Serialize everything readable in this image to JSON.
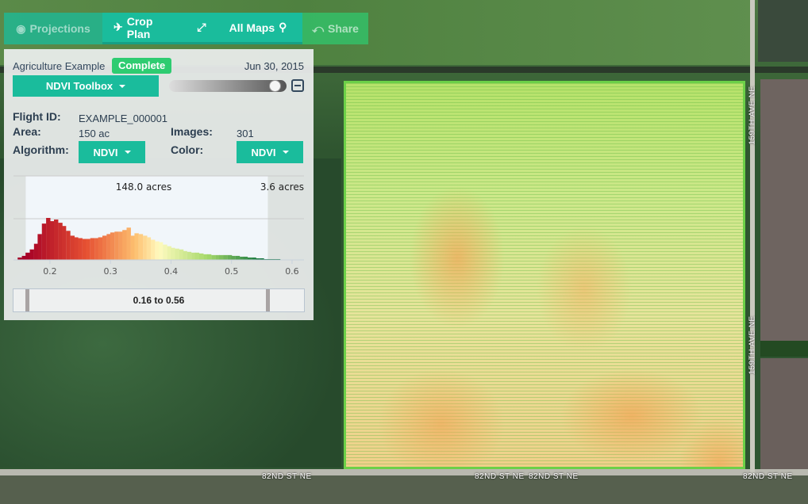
{
  "toolbar": {
    "projections": "Projections",
    "crop_plan": "Crop Plan",
    "all_maps": "All Maps",
    "share": "Share"
  },
  "panel": {
    "project": "Agriculture Example",
    "status": "Complete",
    "date": "Jun 30, 2015",
    "toolbox": "NDVI Toolbox",
    "opacity": 0.95,
    "flight_id_label": "Flight ID:",
    "flight_id": "EXAMPLE_000001",
    "area_label": "Area:",
    "area": "150 ac",
    "images_label": "Images:",
    "images": "301",
    "algorithm_label": "Algorithm:",
    "algorithm": "NDVI",
    "color_label": "Color:",
    "color": "NDVI",
    "range_text": "0.16 to 0.56"
  },
  "roads": {
    "avenue": "159TH AVE NE",
    "street": "82ND ST NE"
  },
  "colors": {
    "accent": "#1abc9c",
    "complete": "#2ecc71"
  },
  "chart_data": {
    "type": "bar",
    "title": "",
    "annotations": [
      "148.0 acres",
      "3.6 acres"
    ],
    "xlim": [
      0.145,
      0.625
    ],
    "ylim": [
      0,
      104
    ],
    "grid_y": [
      52,
      104
    ],
    "selected_range": [
      0.16,
      0.56
    ],
    "xticks": [
      "0.2",
      "0.3",
      "0.4",
      "0.5",
      "0.6"
    ],
    "bin_width": 0.0067,
    "x": [
      0.15,
      0.157,
      0.163,
      0.17,
      0.177,
      0.183,
      0.19,
      0.197,
      0.203,
      0.21,
      0.217,
      0.223,
      0.23,
      0.237,
      0.243,
      0.25,
      0.257,
      0.263,
      0.27,
      0.277,
      0.283,
      0.29,
      0.297,
      0.303,
      0.31,
      0.317,
      0.323,
      0.33,
      0.337,
      0.343,
      0.35,
      0.357,
      0.363,
      0.37,
      0.377,
      0.383,
      0.39,
      0.397,
      0.403,
      0.41,
      0.417,
      0.423,
      0.43,
      0.437,
      0.443,
      0.45,
      0.457,
      0.463,
      0.47,
      0.477,
      0.483,
      0.49,
      0.497,
      0.503,
      0.51,
      0.517,
      0.523,
      0.53,
      0.537,
      0.543,
      0.55,
      0.557,
      0.563,
      0.57,
      0.577
    ],
    "values": [
      3,
      5,
      9,
      13,
      20,
      32,
      45,
      52,
      48,
      50,
      46,
      42,
      36,
      30,
      28,
      27,
      26,
      26,
      27,
      27,
      28,
      30,
      32,
      34,
      35,
      35,
      37,
      40,
      30,
      33,
      32,
      30,
      28,
      25,
      23,
      22,
      19,
      17,
      15,
      14,
      13,
      11,
      10,
      9,
      9,
      8,
      7,
      7,
      6,
      6,
      6,
      6,
      6,
      5,
      5,
      4,
      4,
      3,
      3,
      2,
      2,
      1,
      1,
      1,
      1
    ]
  }
}
